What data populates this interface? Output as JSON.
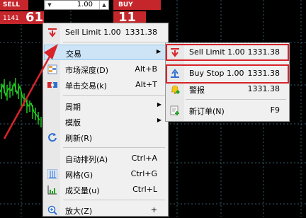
{
  "trade_bar": {
    "sell_label": "SELL",
    "lot_value": "1.00",
    "spin_down": "▼",
    "spin_up": "▲",
    "buy_label": "BUY",
    "sell_price_small": "1141",
    "sell_price_big": "61",
    "buy_price_big": "11"
  },
  "context_menu": {
    "items": [
      {
        "label": "Sell Limit 1.00",
        "shortcut": "1331.38",
        "icon": "sell-limit-icon"
      },
      {
        "label": "交易",
        "shortcut": "",
        "icon": "",
        "submenu": true
      },
      {
        "label": "市场深度(D)",
        "shortcut": "Alt+B",
        "icon": "market-depth-icon"
      },
      {
        "label": "单击交易(k)",
        "shortcut": "Alt+T",
        "icon": "one-click-trading-icon"
      },
      {
        "label": "周期",
        "shortcut": "",
        "submenu": true
      },
      {
        "label": "模版",
        "shortcut": "",
        "submenu": true
      },
      {
        "label": "刷新(R)",
        "shortcut": "",
        "icon": "refresh-icon"
      },
      {
        "label": "自动排列(A)",
        "shortcut": "Ctrl+A"
      },
      {
        "label": "网格(G)",
        "shortcut": "Ctrl+G",
        "icon": "grid-icon"
      },
      {
        "label": "成交量(u)",
        "shortcut": "Ctrl+L",
        "icon": "volume-icon"
      },
      {
        "label": "放大(Z)",
        "shortcut": "+",
        "icon": "zoom-in-icon"
      }
    ]
  },
  "trade_submenu": {
    "items": [
      {
        "label": "Sell Limit 1.00",
        "shortcut": "1331.38",
        "icon": "sell-limit-icon"
      },
      {
        "label": "Buy Stop 1.00",
        "shortcut": "1331.38",
        "icon": "buy-stop-icon"
      },
      {
        "label": "警报",
        "shortcut": "1331.38",
        "icon": "alert-bell-icon"
      },
      {
        "label": "新订单(N)",
        "shortcut": "F9",
        "icon": "new-order-icon"
      }
    ]
  },
  "colors": {
    "accent_red": "#d8232a",
    "chart_green": "#22d422",
    "highlight": "#cde4f7"
  }
}
